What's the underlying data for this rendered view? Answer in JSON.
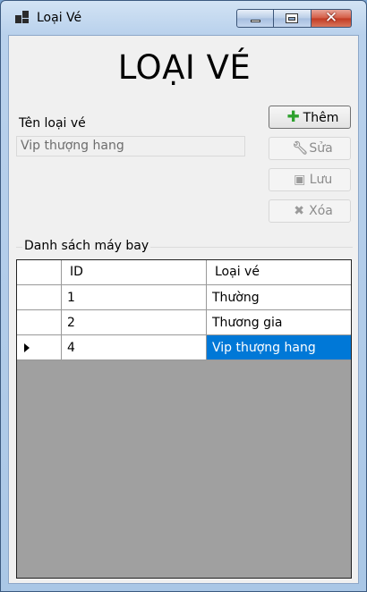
{
  "window": {
    "title": "Loại Vé",
    "minimize_label": "",
    "maximize_label": "",
    "close_label": "✕"
  },
  "form": {
    "heading": "LOẠI VÉ",
    "ten_loai_ve_label": "Tên loại vé",
    "ten_loai_ve_value": "Vip thượng hang"
  },
  "buttons": {
    "them": {
      "label": "Thêm",
      "icon": "plus-icon",
      "enabled": true
    },
    "sua": {
      "label": "Sửa",
      "icon": "wrench-icon",
      "enabled": false
    },
    "luu": {
      "label": "Lưu",
      "icon": "save-icon",
      "enabled": false
    },
    "xoa": {
      "label": "Xóa",
      "icon": "delete-icon",
      "enabled": false
    }
  },
  "group": {
    "label": "Danh sách máy bay"
  },
  "grid": {
    "headers": [
      "",
      "ID",
      "Loại vé"
    ],
    "rows": [
      {
        "id": "1",
        "loai_ve": "Thường"
      },
      {
        "id": "2",
        "loai_ve": "Thương gia"
      },
      {
        "id": "4",
        "loai_ve": "Vip thượng hang"
      }
    ],
    "selected_row_index": 2
  },
  "colors": {
    "selection": "#0078d7",
    "grid_background": "#a0a0a0",
    "add_icon": "#2ea12e"
  }
}
